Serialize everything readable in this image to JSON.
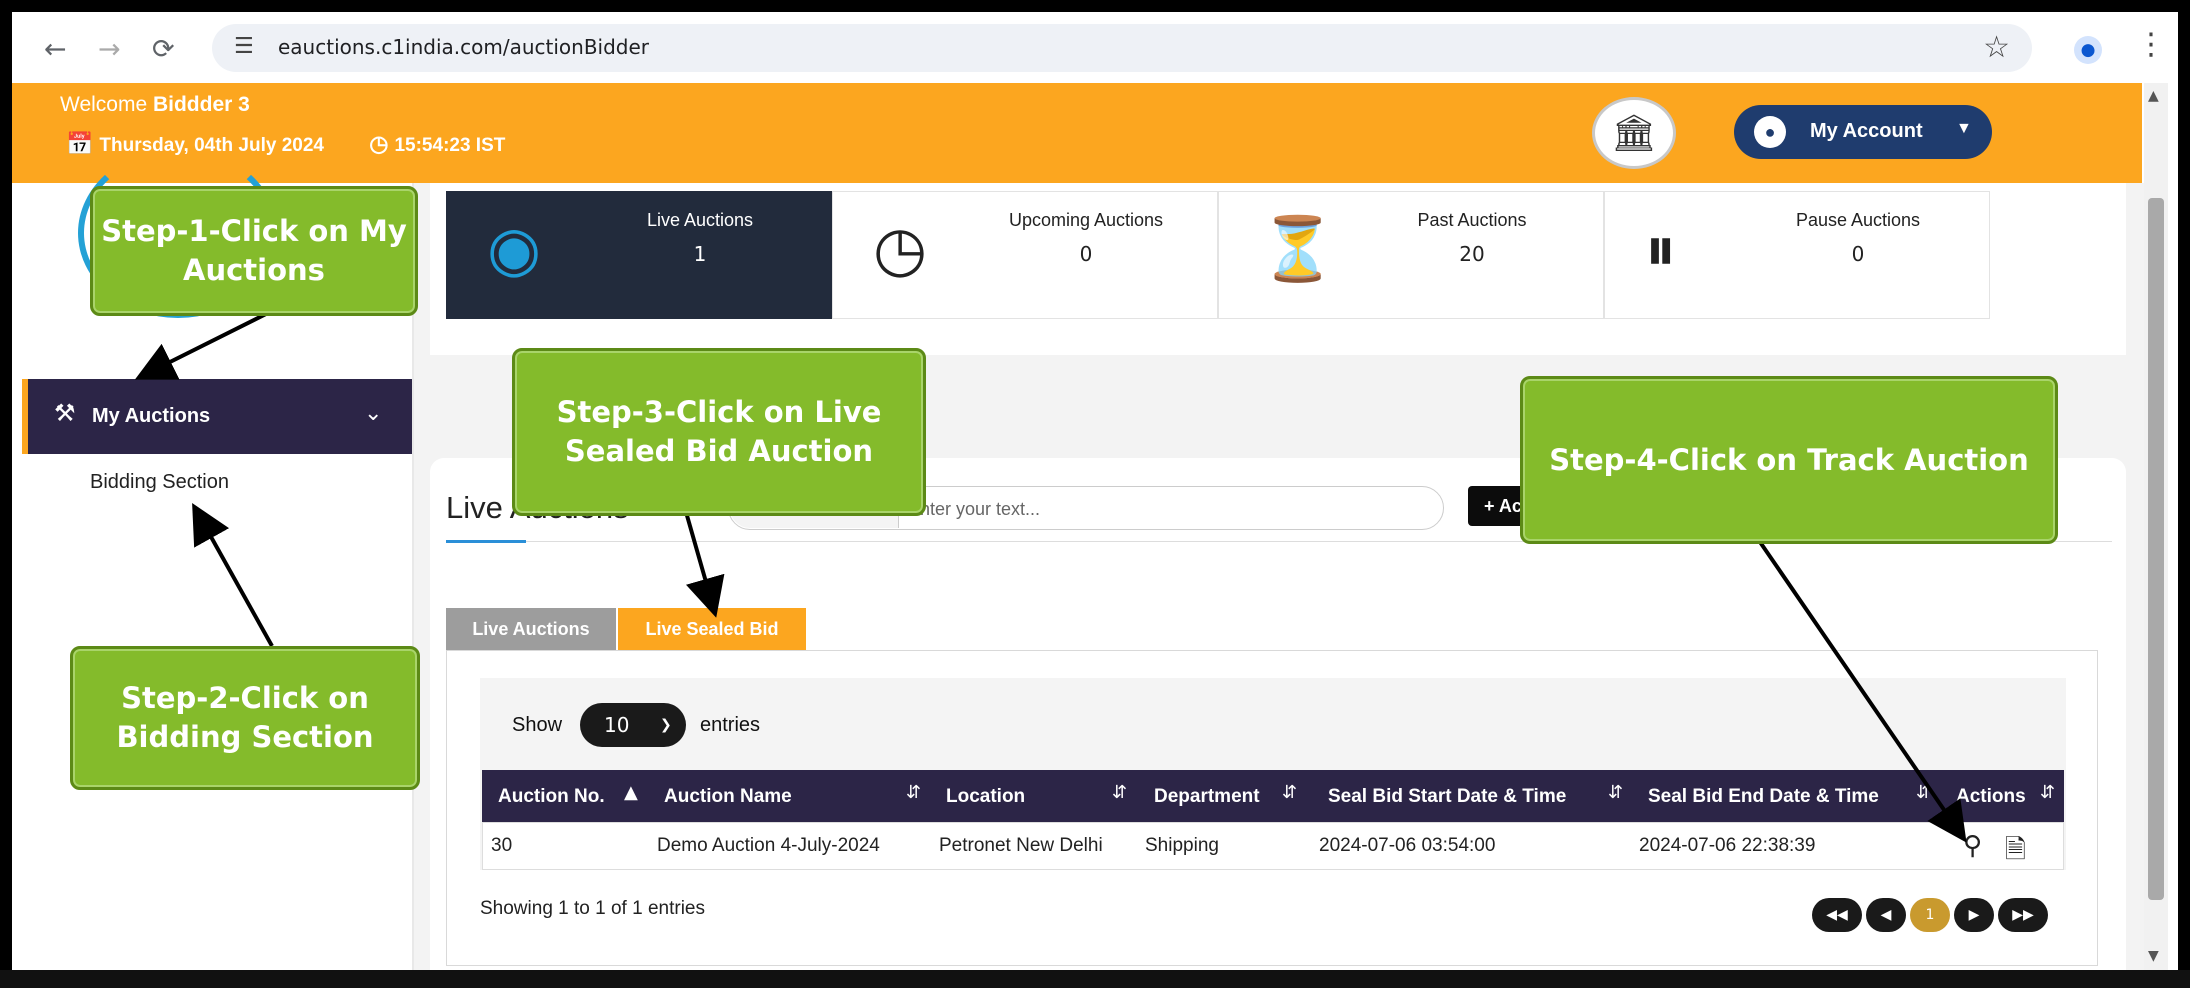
{
  "browser": {
    "url": "eauctions.c1india.com/auctionBidder"
  },
  "header": {
    "welcome_prefix": "Welcome",
    "user_name": "Biddder 3",
    "date": "Thursday, 04th July 2024",
    "time": "15:54:23 IST",
    "account_label": "My Account"
  },
  "sidebar": {
    "my_auctions_label": "My Auctions",
    "bidding_section_label": "Bidding Section"
  },
  "stats": [
    {
      "label": "Live Auctions",
      "value": "1",
      "icon": "live-broadcast-icon",
      "active": true
    },
    {
      "label": "Upcoming Auctions",
      "value": "0",
      "icon": "clock-icon",
      "active": false
    },
    {
      "label": "Past Auctions",
      "value": "20",
      "icon": "history-icon",
      "active": false
    },
    {
      "label": "Pause Auctions",
      "value": "0",
      "icon": "pause-icon",
      "active": false
    }
  ],
  "main": {
    "title": "Live Auctions",
    "search_placeholder": "Enter your text...",
    "add_button": "+ Ac",
    "tabs": [
      {
        "label": "Live Auctions",
        "active": false
      },
      {
        "label": "Live Sealed Bid",
        "active": true
      }
    ],
    "show_label": "Show",
    "entries_value": "10",
    "entries_label": "entries",
    "table": {
      "columns": [
        "Auction No.",
        "Auction Name",
        "Location",
        "Department",
        "Seal Bid Start Date & Time",
        "Seal Bid End Date & Time",
        "Actions"
      ],
      "rows": [
        [
          "30",
          "Demo Auction 4-July-2024",
          "Petronet New Delhi",
          "Shipping",
          "2024-07-06 03:54:00",
          "2024-07-06 22:38:39"
        ]
      ]
    },
    "showing_text": "Showing 1 to 1 of 1 entries",
    "current_page": "1"
  },
  "annotations": {
    "step1": "Step-1-Click on My Auctions",
    "step2": "Step-2-Click on Bidding Section",
    "step3": "Step-3-Click on Live Sealed Bid Auction",
    "step4": "Step-4-Click on Track Auction"
  },
  "colors": {
    "header_orange": "#fca61f",
    "sidebar_dark": "#2c2547",
    "active_card": "#222b3c",
    "callout_green": "#84bb2b",
    "account_blue": "#1f3c6e"
  }
}
